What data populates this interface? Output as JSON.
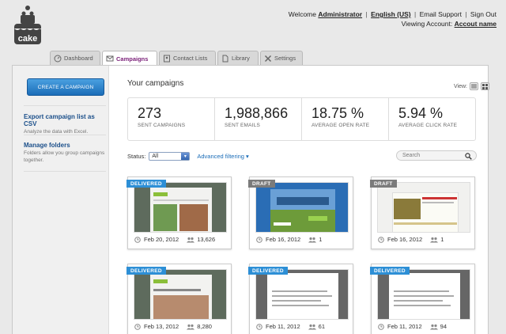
{
  "app": {
    "logo_text": "cake"
  },
  "account": {
    "welcome_prefix": "Welcome",
    "user": "Administrator",
    "language": "English (US)",
    "email_support": "Email Support",
    "sign_out": "Sign Out",
    "viewing_prefix": "Viewing Account:",
    "account_name": "Accout name"
  },
  "tabs": [
    {
      "label": "Dashboard",
      "icon": "speedometer-icon"
    },
    {
      "label": "Campaigns",
      "icon": "envelope-icon",
      "active": true
    },
    {
      "label": "Contact Lists",
      "icon": "address-book-icon"
    },
    {
      "label": "Library",
      "icon": "document-icon"
    },
    {
      "label": "Settings",
      "icon": "tools-icon"
    }
  ],
  "sidebar": {
    "create_button": "CREATE A CAMPAIGN",
    "export_title": "Export campaign list as CSV",
    "export_desc": "Analyze the data with Excel.",
    "folders_title": "Manage folders",
    "folders_desc": "Folders allow you group campaigns together."
  },
  "main": {
    "heading": "Your campaigns",
    "view_label": "View:",
    "stats": [
      {
        "value": "273",
        "label": "SENT CAMPAIGNS"
      },
      {
        "value": "1,988,866",
        "label": "SENT EMAILS"
      },
      {
        "value": "18.75 %",
        "label": "AVERAGE OPEN RATE"
      },
      {
        "value": "5.94 %",
        "label": "AVERAGE CLICK RATE"
      }
    ],
    "status_label": "Status:",
    "status_value": "All",
    "advanced_filtering": "Advanced filtering ▾",
    "search_placeholder": "Search"
  },
  "campaigns": [
    {
      "status": "DELIVERED",
      "date": "Feb 20, 2012",
      "count": "13,626"
    },
    {
      "status": "DRAFT",
      "date": "Feb 16, 2012",
      "count": "1"
    },
    {
      "status": "DRAFT",
      "date": "Feb 16, 2012",
      "count": "1"
    },
    {
      "status": "DELIVERED",
      "date": "Feb 13, 2012",
      "count": "8,280"
    },
    {
      "status": "DELIVERED",
      "date": "Feb 11, 2012",
      "count": "61"
    },
    {
      "status": "DELIVERED",
      "date": "Feb 11, 2012",
      "count": "94"
    }
  ],
  "colors": {
    "brand": "#7a1f78",
    "accent": "#2d8fd6",
    "draft": "#7b7b7b"
  }
}
